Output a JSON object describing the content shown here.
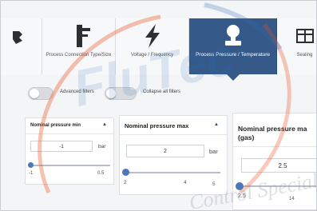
{
  "tabs": [
    {
      "label": "",
      "icon": "network-icon",
      "active": false
    },
    {
      "label": "Process Connection Type/Size",
      "icon": "pipe-connection-icon",
      "active": false
    },
    {
      "label": "Voltage / Frequency",
      "icon": "lightning-bolt-icon",
      "active": false
    },
    {
      "label": "Process Pressure / Temperature",
      "icon": "pressure-gauge-icon",
      "active": true
    },
    {
      "label": "Sealing",
      "icon": "sealing-icon",
      "active": false
    }
  ],
  "toggles": {
    "advanced_label": "Advanced filters",
    "collapse_label": "Collapse all filters"
  },
  "filters": [
    {
      "title": "Nominal pressure min",
      "value": "-1",
      "unit": "bar",
      "ticks": [
        "-1",
        "0.5"
      ]
    },
    {
      "title": "Nominal pressure max",
      "value": "2",
      "unit": "bar",
      "ticks": [
        "2",
        "4",
        "5"
      ]
    },
    {
      "title": "Nominal pressure ma",
      "subtitle": "(gas)",
      "value": "2.5",
      "ticks": [
        "2.5",
        "14"
      ]
    }
  ],
  "watermark": {
    "brand": "FluTec",
    "text": "Control Speciali",
    "color": "#e8501e"
  },
  "colors": {
    "active_tab": "#355a8a",
    "slider_thumb": "#4a78b8"
  }
}
